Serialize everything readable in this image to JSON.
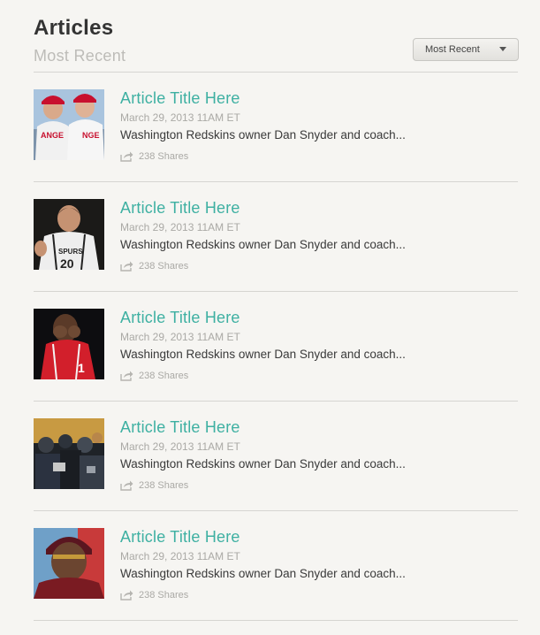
{
  "header": {
    "title": "Articles",
    "subtitle": "Most Recent",
    "sort_label": "Most Recent"
  },
  "articles": [
    {
      "title": "Article Title Here",
      "date": "March 29, 2013 11AM ET",
      "summary": "Washington Redskins owner Dan Snyder and coach...",
      "shares": "238 Shares",
      "thumb": "angels-players"
    },
    {
      "title": "Article Title Here",
      "date": "March 29, 2013 11AM ET",
      "summary": "Washington Redskins owner Dan Snyder and coach...",
      "shares": "238 Shares",
      "thumb": "spurs-player"
    },
    {
      "title": "Article Title Here",
      "date": "March 29, 2013 11AM ET",
      "summary": "Washington Redskins owner Dan Snyder and coach...",
      "shares": "238 Shares",
      "thumb": "red-jersey-player"
    },
    {
      "title": "Article Title Here",
      "date": "March 29, 2013 11AM ET",
      "summary": "Washington Redskins owner Dan Snyder and coach...",
      "shares": "238 Shares",
      "thumb": "crowd-scene"
    },
    {
      "title": "Article Title Here",
      "date": "March 29, 2013 11AM ET",
      "summary": "Washington Redskins owner Dan Snyder and coach...",
      "shares": "238 Shares",
      "thumb": "redskins-player"
    }
  ],
  "colors": {
    "accent": "#3eb0a2",
    "background": "#f6f5f2",
    "muted": "#aaa9a5"
  }
}
